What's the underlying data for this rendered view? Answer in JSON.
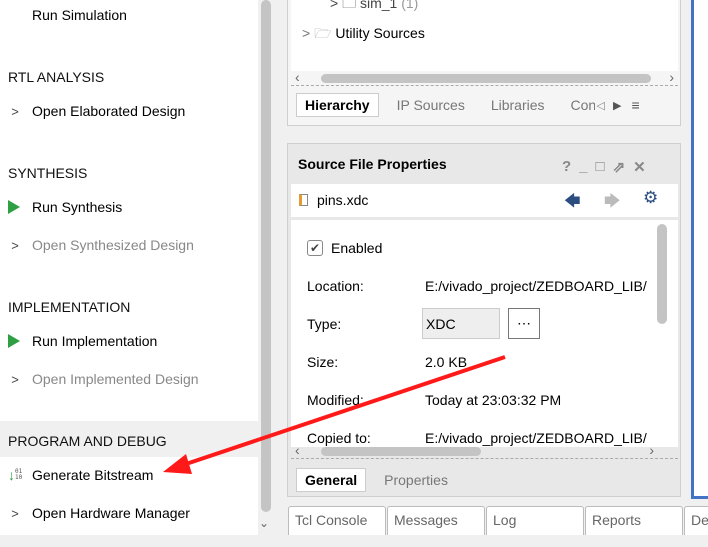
{
  "flow_navigator": {
    "run_simulation": "Run Simulation",
    "rtl_header": "RTL ANALYSIS",
    "open_elaborated": "Open Elaborated Design",
    "synth_header": "SYNTHESIS",
    "run_synthesis": "Run Synthesis",
    "open_synthesized": "Open Synthesized Design",
    "impl_header": "IMPLEMENTATION",
    "run_implementation": "Run Implementation",
    "open_implemented": "Open Implemented Design",
    "prog_header": "PROGRAM AND DEBUG",
    "generate_bitstream": "Generate Bitstream",
    "open_hw_manager": "Open Hardware Manager",
    "bitstream_icon_text": "01 10"
  },
  "sources": {
    "tree": [
      {
        "label": "sim_1",
        "count": "(1)"
      },
      {
        "label": "Utility Sources"
      }
    ],
    "tabs": [
      "Hierarchy",
      "IP Sources",
      "Libraries",
      "Con"
    ],
    "active_tab": "Hierarchy"
  },
  "properties": {
    "title": "Source File Properties",
    "file": "pins.xdc",
    "enabled_label": "Enabled",
    "enabled": true,
    "rows": [
      {
        "label": "Location:",
        "value": "E:/vivado_project/ZEDBOARD_LIB/"
      },
      {
        "label": "Type:",
        "value": "XDC"
      },
      {
        "label": "Size:",
        "value": "2.0 KB"
      },
      {
        "label": "Modified:",
        "value": "Today at 23:03:32 PM"
      },
      {
        "label": "Copied to:",
        "value": "E:/vivado_project/ZEDBOARD_LIB/"
      }
    ],
    "type_button": "⋯",
    "tabs": [
      "General",
      "Properties"
    ],
    "active_tab": "General"
  },
  "bottom_tabs": [
    "Tcl Console",
    "Messages",
    "Log",
    "Reports",
    "De"
  ],
  "colors": {
    "annotation_arrow": "#ff1a1a",
    "accent_border": "#4472c4",
    "run_green": "#2ea043"
  }
}
